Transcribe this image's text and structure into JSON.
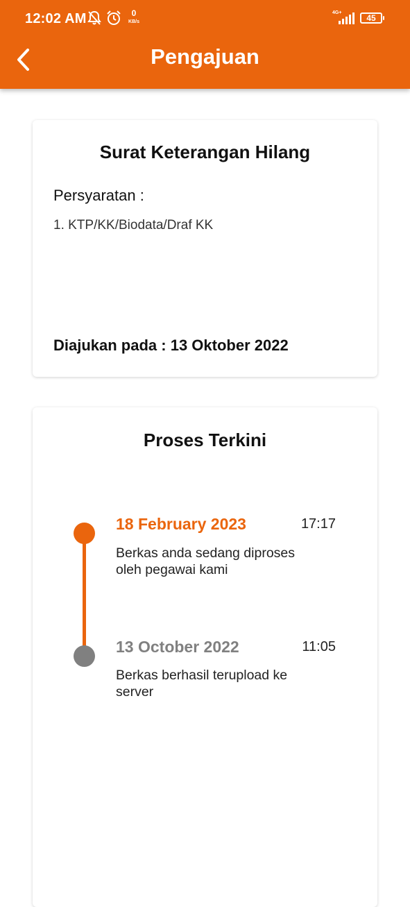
{
  "status_bar": {
    "time": "12:02 AM",
    "net_speed_value": "0",
    "net_speed_unit": "KB/s",
    "network_type": "4G+",
    "battery": "45",
    "icons": [
      "notifications-off-icon",
      "alarm-icon",
      "signal-icon",
      "battery-icon"
    ]
  },
  "header": {
    "title": "Pengajuan",
    "back_icon": "chevron-left-icon",
    "bg_color": "#EA650D"
  },
  "document_card": {
    "title": "Surat Keterangan Hilang",
    "requirements_heading": "Persyaratan :",
    "requirements": [
      "1. KTP/KK/Biodata/Draf KK"
    ],
    "submitted_on": "Diajukan pada : 13 Oktober 2022"
  },
  "process_card": {
    "title": "Proses Terkini",
    "timeline": [
      {
        "date": "18 February 2023",
        "time": "17:17",
        "description": "Berkas anda sedang diproses oleh pegawai kami",
        "color": "#EA650D"
      },
      {
        "date": "13 October 2022",
        "time": "11:05",
        "description": "Berkas berhasil terupload ke server",
        "color": "#808080"
      }
    ]
  }
}
